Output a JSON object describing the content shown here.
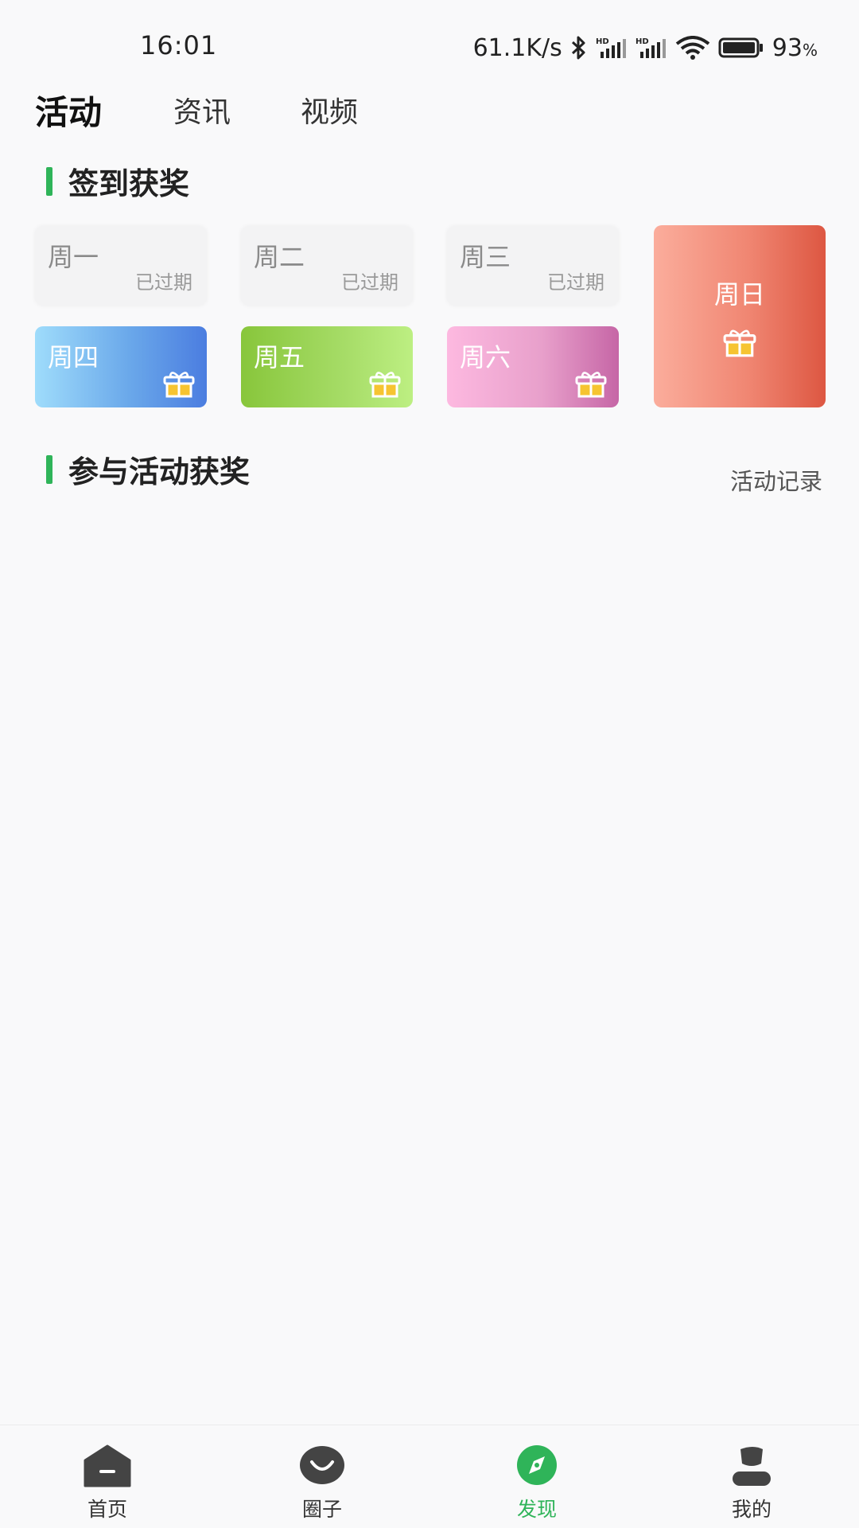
{
  "status_bar": {
    "time": "16:01",
    "network_speed": "61.1K/s",
    "battery_percent": "93",
    "battery_suffix": "%",
    "icons": [
      "bluetooth-icon",
      "signal-hd-icon",
      "signal-hd-icon",
      "wifi-icon",
      "battery-icon"
    ]
  },
  "top_tabs": [
    {
      "label": "活动",
      "active": true
    },
    {
      "label": "资讯",
      "active": false
    },
    {
      "label": "视频",
      "active": false
    }
  ],
  "sections": {
    "signin": {
      "title": "签到获奖"
    },
    "participate": {
      "title": "参与活动获奖",
      "record_link": "活动记录"
    }
  },
  "days": [
    {
      "label": "周一",
      "status": "已过期",
      "expired": true
    },
    {
      "label": "周二",
      "status": "已过期",
      "expired": true
    },
    {
      "label": "周三",
      "status": "已过期",
      "expired": true
    },
    {
      "label": "周四",
      "expired": false,
      "icon": "gift-icon"
    },
    {
      "label": "周五",
      "expired": false,
      "icon": "gift-icon"
    },
    {
      "label": "周六",
      "expired": false,
      "icon": "gift-icon"
    },
    {
      "label": "周日",
      "expired": false,
      "icon": "gift-icon"
    }
  ],
  "colors": {
    "accent": "#2fb459",
    "background": "#f9f9fa"
  },
  "bottom_nav": [
    {
      "label": "首页",
      "icon": "home-icon",
      "active": false
    },
    {
      "label": "圈子",
      "icon": "circle-smile-icon",
      "active": false
    },
    {
      "label": "发现",
      "icon": "compass-icon",
      "active": true
    },
    {
      "label": "我的",
      "icon": "user-icon",
      "active": false
    }
  ]
}
